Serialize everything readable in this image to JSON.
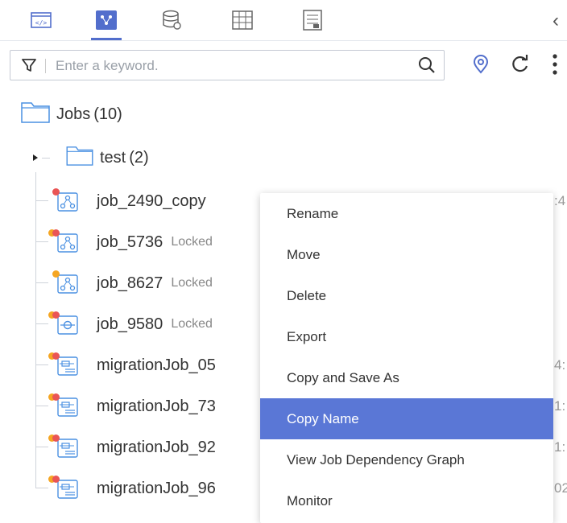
{
  "colors": {
    "accent": "#526ecc",
    "folder": "#4a90e2",
    "dot_red": "#ea5555",
    "dot_orange": "#f5a623",
    "menu_highlight": "#5a77d6"
  },
  "toolbar": {
    "icons": [
      "code-icon",
      "job-graph-icon",
      "database-icon",
      "table-icon",
      "document-icon"
    ],
    "collapse_glyph": "‹"
  },
  "search": {
    "placeholder": "Enter a keyword."
  },
  "tree": {
    "root": {
      "label": "Jobs",
      "count": "(10)"
    },
    "folder": {
      "label": "test",
      "count": "(2)"
    },
    "jobs": [
      {
        "name": "job_2490_copy",
        "status": "",
        "trail": ":4",
        "dots": [
          "red"
        ],
        "icon": "workflow-icon"
      },
      {
        "name": "job_5736",
        "status": "Locked",
        "trail": "",
        "dots": [
          "orange",
          "red"
        ],
        "icon": "workflow-icon"
      },
      {
        "name": "job_8627",
        "status": "Locked",
        "trail": "",
        "dots": [
          "orange"
        ],
        "icon": "workflow-icon"
      },
      {
        "name": "job_9580",
        "status": "Locked",
        "trail": "",
        "dots": [
          "orange",
          "red"
        ],
        "icon": "realtime-job-icon"
      },
      {
        "name": "migrationJob_05",
        "status": "",
        "trail": "4:",
        "dots": [
          "orange",
          "red"
        ],
        "icon": "migration-icon"
      },
      {
        "name": "migrationJob_73",
        "status": "",
        "trail": "1:",
        "dots": [
          "orange",
          "red"
        ],
        "icon": "migration-icon"
      },
      {
        "name": "migrationJob_92",
        "status": "",
        "trail": "1:",
        "dots": [
          "orange",
          "red"
        ],
        "icon": "migration-icon"
      },
      {
        "name": "migrationJob_96",
        "status": "",
        "trail": "02",
        "dots": [
          "orange",
          "red"
        ],
        "icon": "migration-icon"
      }
    ]
  },
  "context_menu": {
    "items": [
      "Rename",
      "Move",
      "Delete",
      "Export",
      "Copy and Save As",
      "Copy Name",
      "View Job Dependency Graph",
      "Monitor"
    ],
    "active": "Copy Name"
  }
}
